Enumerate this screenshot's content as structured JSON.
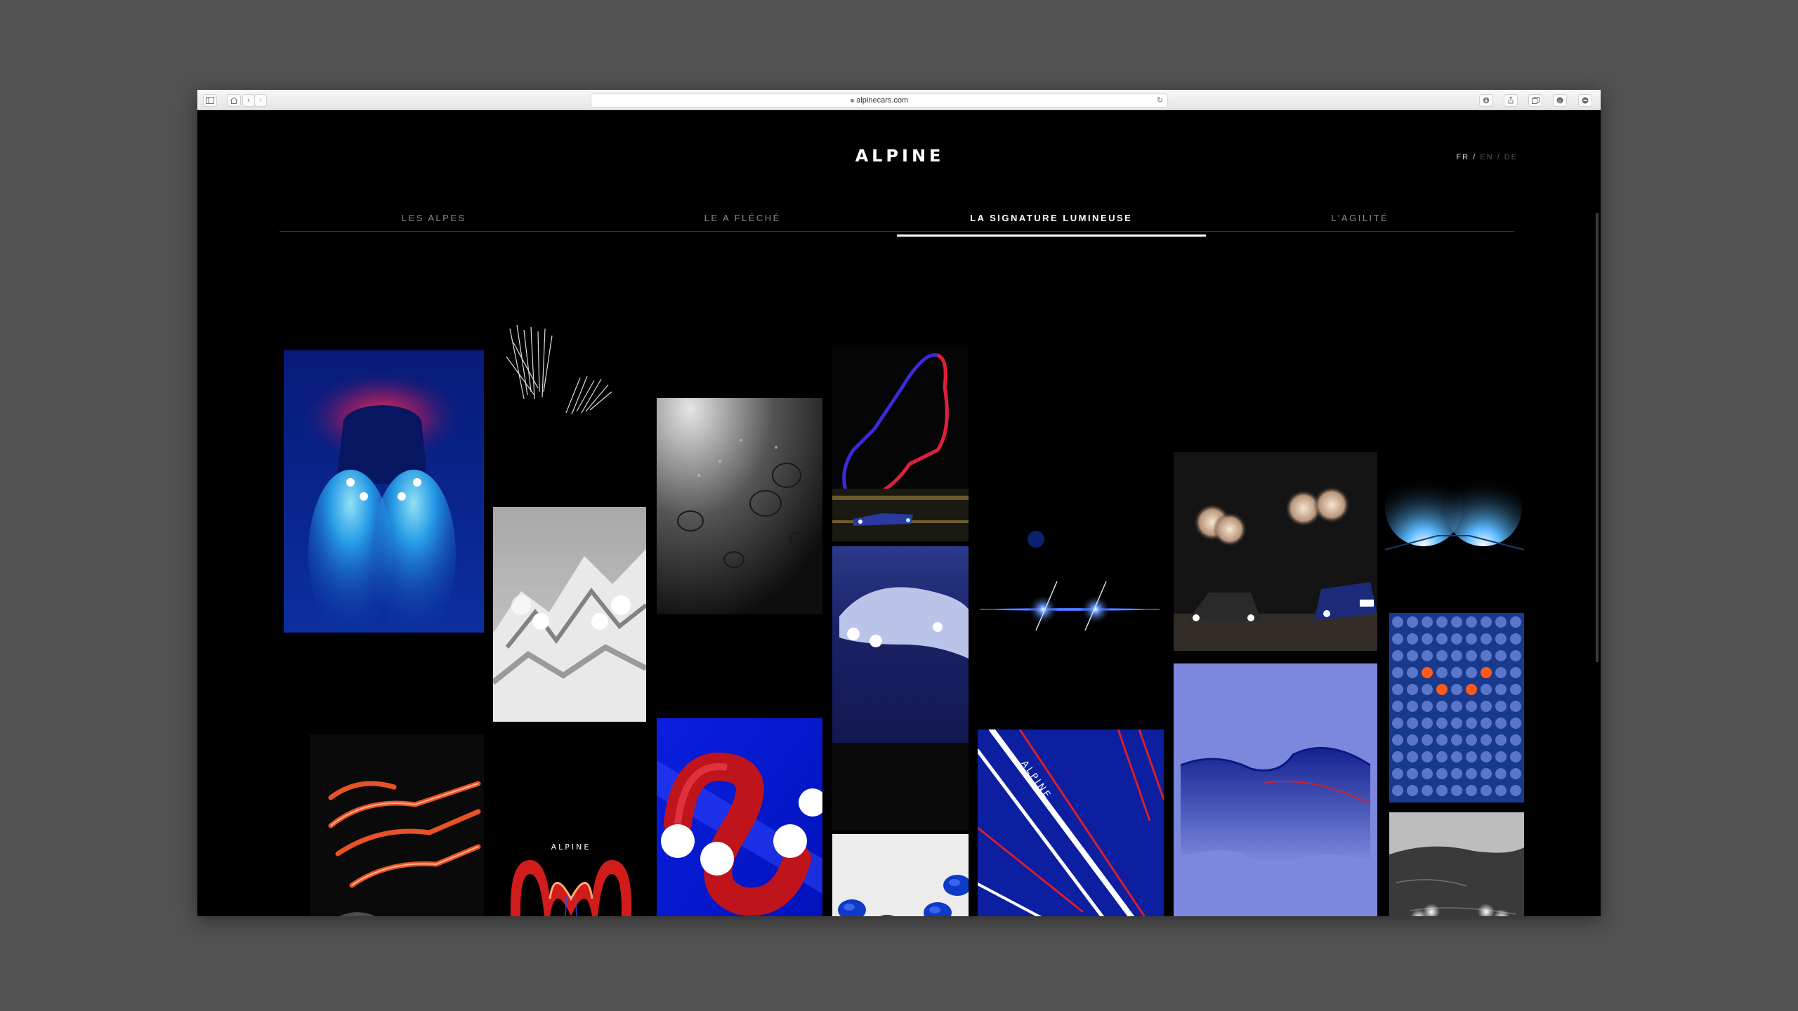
{
  "browser": {
    "url": "alpinecars.com",
    "back_icon": "‹",
    "forward_icon": "›",
    "reload_icon": "↻"
  },
  "site": {
    "logo": "ALPINE",
    "languages": {
      "fr": "FR",
      "sep1": "/",
      "en": "EN",
      "sep2": "/",
      "de": "DE"
    },
    "tabs": [
      {
        "label": "LES ALPES"
      },
      {
        "label": "LE A FLÉCHÉ"
      },
      {
        "label": "LA SIGNATURE LUMINEUSE"
      },
      {
        "label": "L'AGILITÉ"
      }
    ],
    "active_tab": "LA SIGNATURE LUMINEUSE",
    "poster_logo": "ALPINE",
    "diagonal_poster_text": "ALPINE"
  },
  "colors": {
    "accent_blue": "#0a1fb8",
    "accent_red": "#c2121f",
    "periwinkle": "#7b88dd",
    "page_bg": "#000000"
  }
}
